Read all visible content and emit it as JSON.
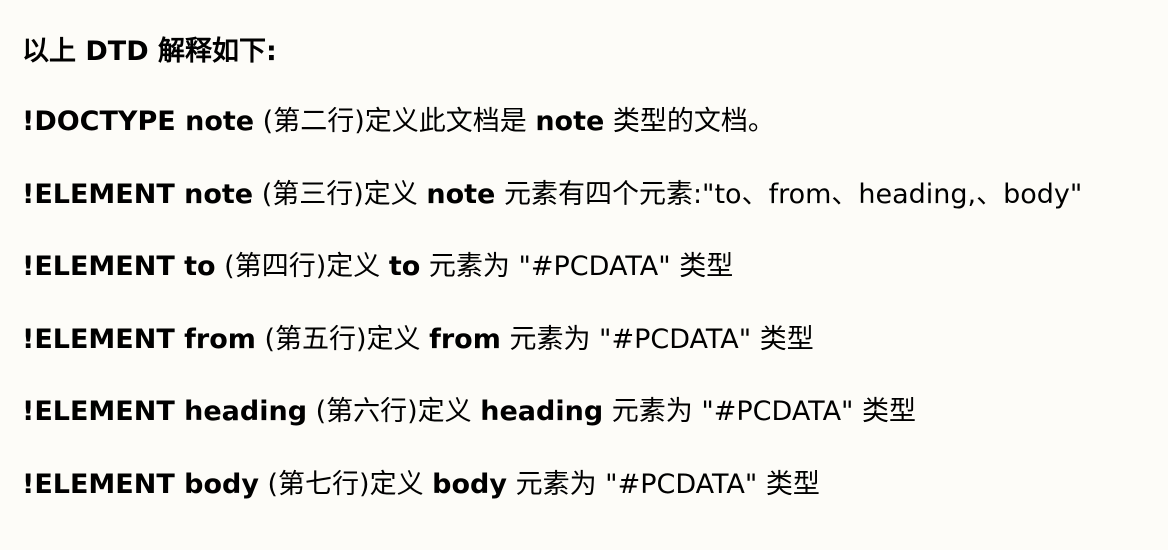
{
  "heading": "以上 DTD 解释如下:",
  "lines": [
    {
      "keyword": "!DOCTYPE note",
      "row_note": " (第二行)定义此文档是 ",
      "target": "note",
      "desc": " 类型的文档。"
    },
    {
      "keyword": "!ELEMENT note",
      "row_note": " (第三行)定义 ",
      "target": "note",
      "desc": " 元素有四个元素:\"to、from、heading,、body\""
    },
    {
      "keyword": "!ELEMENT to",
      "row_note": " (第四行)定义 ",
      "target": "to",
      "desc": " 元素为 \"#PCDATA\" 类型"
    },
    {
      "keyword": "!ELEMENT from",
      "row_note": " (第五行)定义 ",
      "target": "from",
      "desc": " 元素为 \"#PCDATA\" 类型"
    },
    {
      "keyword": "!ELEMENT heading",
      "row_note": " (第六行)定义 ",
      "target": "heading",
      "desc": " 元素为 \"#PCDATA\" 类型"
    },
    {
      "keyword": "!ELEMENT body",
      "row_note": " (第七行)定义 ",
      "target": "body",
      "desc": " 元素为 \"#PCDATA\" 类型"
    }
  ]
}
